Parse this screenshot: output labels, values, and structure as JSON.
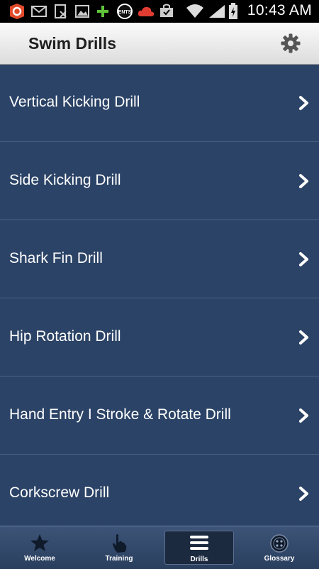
{
  "status": {
    "time": "10:43 AM"
  },
  "header": {
    "title": "Swim Drills"
  },
  "drills": [
    {
      "label": "Vertical Kicking Drill"
    },
    {
      "label": "Side Kicking Drill"
    },
    {
      "label": "Shark Fin Drill"
    },
    {
      "label": "Hip Rotation Drill"
    },
    {
      "label": "Hand Entry I Stroke & Rotate Drill"
    },
    {
      "label": "Corkscrew Drill"
    }
  ],
  "tabs": [
    {
      "label": "Welcome",
      "icon": "star-icon"
    },
    {
      "label": "Training",
      "icon": "hand-pointer-icon"
    },
    {
      "label": "Drills",
      "icon": "list-icon",
      "active": true
    },
    {
      "label": "Glossary",
      "icon": "glossary-icon"
    }
  ],
  "colors": {
    "list_bg": "#2b4366",
    "divider": "#4e6283",
    "header_bg": "#eeeeee"
  }
}
